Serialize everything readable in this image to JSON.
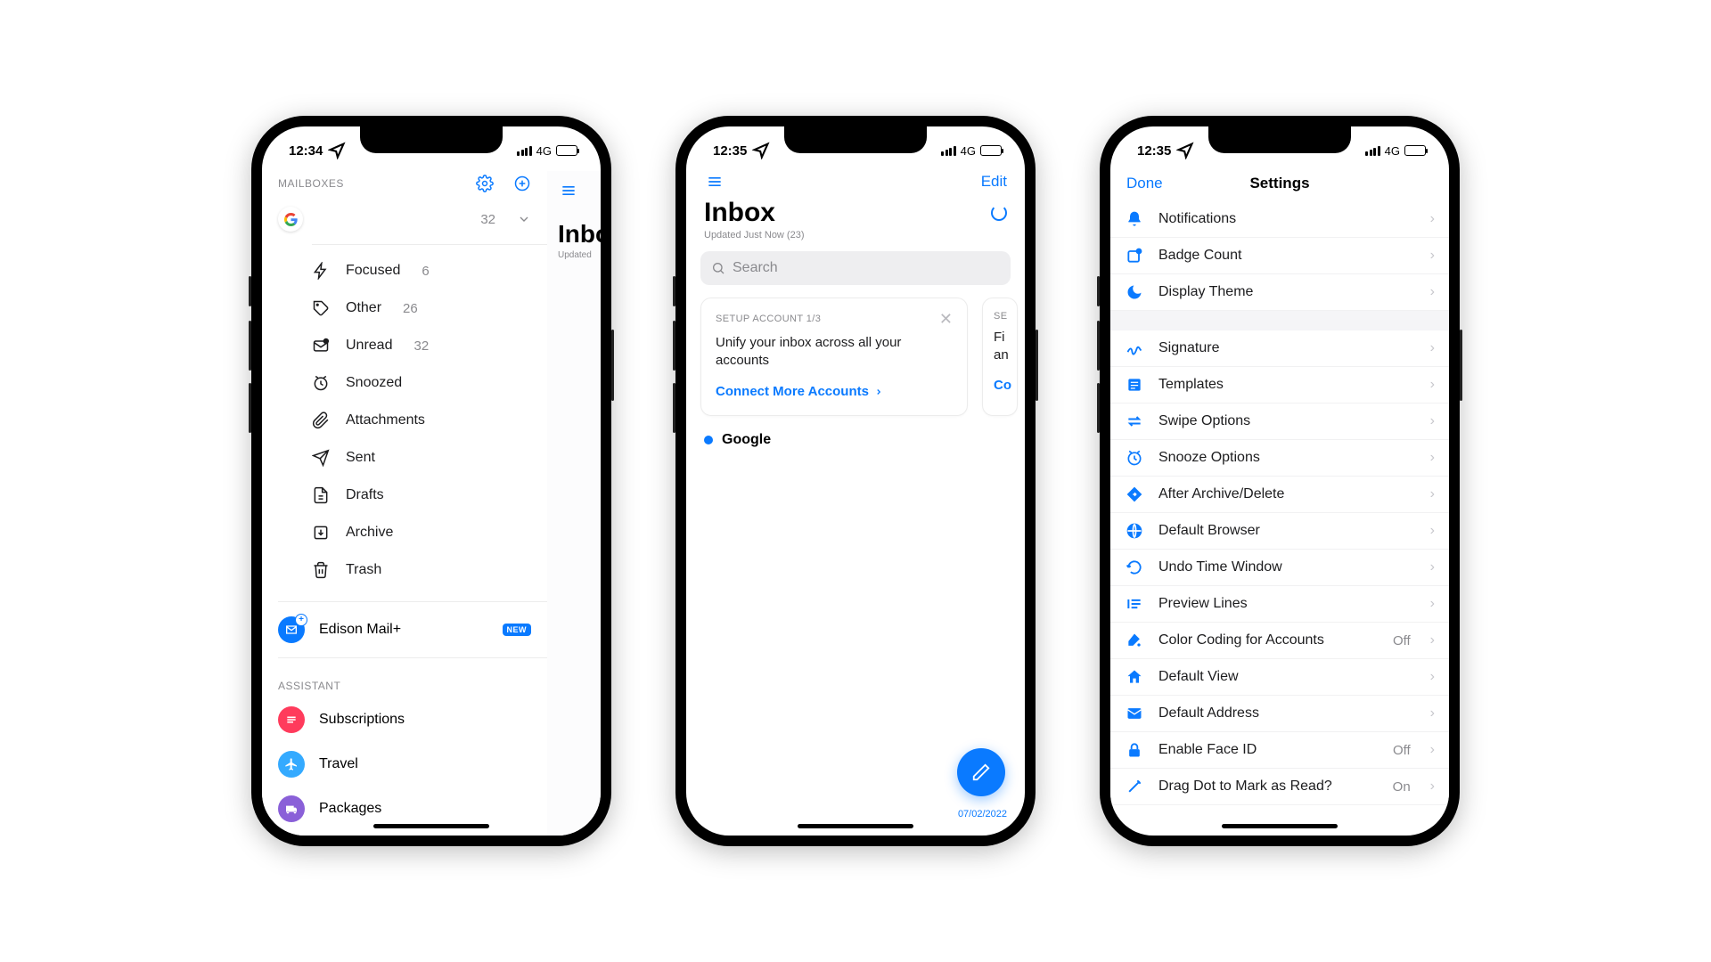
{
  "status": {
    "time1": "12:34",
    "time2": "12:35",
    "time3": "12:35",
    "net": "4G"
  },
  "screen1": {
    "mailboxes_label": "MAILBOXES",
    "account_count": "32",
    "folders": [
      {
        "label": "Focused",
        "count": "6"
      },
      {
        "label": "Other",
        "count": "26"
      },
      {
        "label": "Unread",
        "count": "32"
      },
      {
        "label": "Snoozed",
        "count": ""
      },
      {
        "label": "Attachments",
        "count": ""
      },
      {
        "label": "Sent",
        "count": ""
      },
      {
        "label": "Drafts",
        "count": ""
      },
      {
        "label": "Archive",
        "count": ""
      },
      {
        "label": "Trash",
        "count": ""
      }
    ],
    "plus_label": "Edison Mail+",
    "plus_badge": "NEW",
    "assistant_label": "ASSISTANT",
    "assistant": [
      {
        "label": "Subscriptions"
      },
      {
        "label": "Travel"
      },
      {
        "label": "Packages"
      }
    ],
    "peek_title": "Inbox",
    "peek_sub": "Updated"
  },
  "screen2": {
    "edit": "Edit",
    "title": "Inbox",
    "subtitle": "Updated Just Now (23)",
    "search_placeholder": "Search",
    "card": {
      "step": "SETUP ACCOUNT 1/3",
      "body": "Unify your inbox across all your accounts",
      "cta": "Connect More Accounts"
    },
    "card2_step_prefix": "SE",
    "card2_body_l1": "Fi",
    "card2_body_l2": "an",
    "card2_cta_prefix": "Co",
    "section": "Google",
    "date": "07/02/2022"
  },
  "screen3": {
    "done": "Done",
    "title": "Settings",
    "group1": [
      {
        "label": "Notifications",
        "val": ""
      },
      {
        "label": "Badge Count",
        "val": ""
      },
      {
        "label": "Display Theme",
        "val": ""
      }
    ],
    "group2": [
      {
        "label": "Signature",
        "val": ""
      },
      {
        "label": "Templates",
        "val": ""
      },
      {
        "label": "Swipe Options",
        "val": ""
      },
      {
        "label": "Snooze Options",
        "val": ""
      },
      {
        "label": "After Archive/Delete",
        "val": ""
      },
      {
        "label": "Default Browser",
        "val": ""
      },
      {
        "label": "Undo Time Window",
        "val": ""
      },
      {
        "label": "Preview Lines",
        "val": ""
      },
      {
        "label": "Color Coding for Accounts",
        "val": "Off"
      },
      {
        "label": "Default View",
        "val": ""
      },
      {
        "label": "Default Address",
        "val": ""
      },
      {
        "label": "Enable Face ID",
        "val": "Off"
      },
      {
        "label": "Drag Dot to Mark as Read?",
        "val": "On"
      }
    ]
  }
}
